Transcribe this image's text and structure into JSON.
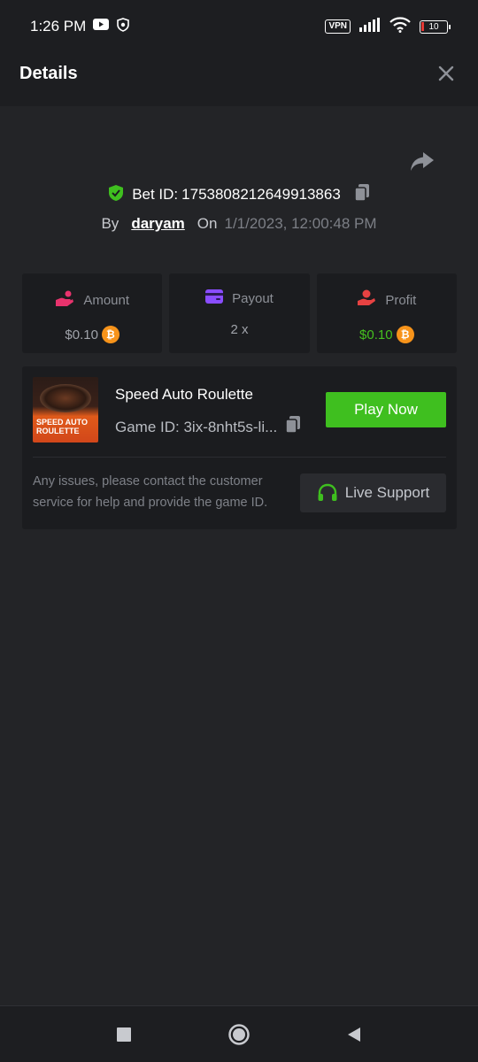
{
  "status_bar": {
    "time": "1:26 PM",
    "vpn": "VPN",
    "battery": "10"
  },
  "header": {
    "title": "Details"
  },
  "bet": {
    "id_label": "Bet ID:",
    "id_value": "1753808212649913863",
    "by_label": "By",
    "username": "daryam",
    "on_label": "On",
    "datetime": "1/1/2023, 12:00:48 PM"
  },
  "stats": [
    {
      "label": "Amount",
      "value": "$0.10",
      "icon": "hand-coin-icon",
      "color": "#e8336d"
    },
    {
      "label": "Payout",
      "value": "2 x",
      "icon": "wallet-card-icon",
      "color": "#8a4dff"
    },
    {
      "label": "Profit",
      "value": "$0.10",
      "icon": "hand-money-icon",
      "color": "#e84242"
    }
  ],
  "game": {
    "title": "Speed Auto Roulette",
    "id_label": "Game ID: 3ix-8nht5s-li...",
    "thumb_text": "Speed Auto Roulette",
    "play_label": "Play Now",
    "help_text": "Any issues, please contact the customer service for help and provide the game ID.",
    "support_label": "Live Support"
  },
  "colors": {
    "accent_green": "#3fbf1f",
    "profit_green": "#45c01f",
    "coin_orange": "#f7931a",
    "background": "#232427"
  }
}
